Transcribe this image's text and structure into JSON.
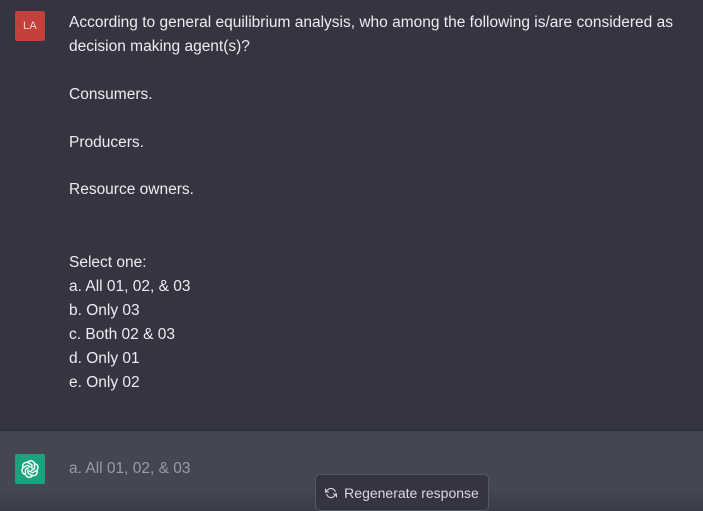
{
  "user": {
    "avatar_initials": "LA",
    "avatar_color": "#c4403a",
    "question_lines": [
      "According to general equilibrium analysis, who among the following is/are considered as",
      "decision making agent(s)?"
    ],
    "agents": [
      "Consumers.",
      "Producers.",
      "Resource owners."
    ],
    "select_label": "Select one:",
    "options": [
      "a. All 01, 02, & 03",
      "b. Only 03",
      "c. Both 02 & 03",
      "d. Only 01",
      "e. Only 02"
    ]
  },
  "assistant": {
    "avatar_icon": "openai-logo-icon",
    "avatar_color": "#19a37f",
    "answer": "a. All 01, 02, & 03"
  },
  "regenerate": {
    "icon": "refresh-icon",
    "label": "Regenerate response"
  },
  "colors": {
    "background": "#343541",
    "assistant_background": "#444654",
    "text": "#ececf1"
  }
}
